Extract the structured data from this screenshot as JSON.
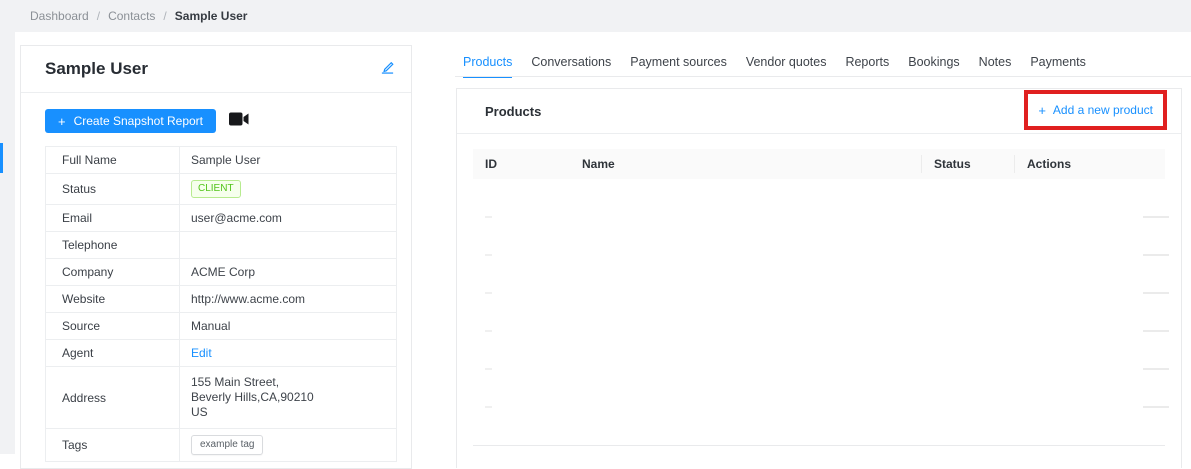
{
  "breadcrumb": {
    "separator": "/",
    "items": [
      {
        "label": "Dashboard",
        "current": false
      },
      {
        "label": "Contacts",
        "current": false
      },
      {
        "label": "Sample User",
        "current": true
      }
    ]
  },
  "contact_card": {
    "title": "Sample User",
    "edit_icon": "pencil-edit-icon",
    "snapshot_button": {
      "icon": "plus-icon",
      "label": "Create Snapshot Report"
    },
    "camera_icon": "video-camera-icon",
    "fields": [
      {
        "label": "Full Name",
        "type": "text",
        "value": "Sample User"
      },
      {
        "label": "Status",
        "type": "badge",
        "value": "CLIENT"
      },
      {
        "label": "Email",
        "type": "text",
        "value": "user@acme.com"
      },
      {
        "label": "Telephone",
        "type": "text",
        "value": ""
      },
      {
        "label": "Company",
        "type": "text",
        "value": "ACME Corp"
      },
      {
        "label": "Website",
        "type": "text",
        "value": "http://www.acme.com"
      },
      {
        "label": "Source",
        "type": "text",
        "value": "Manual"
      },
      {
        "label": "Agent",
        "type": "link",
        "value": "Edit"
      },
      {
        "label": "Address",
        "type": "multiline",
        "lines": [
          "155 Main Street,",
          "Beverly Hills,CA,90210",
          "US"
        ]
      },
      {
        "label": "Tags",
        "type": "tag",
        "value": "example tag"
      }
    ]
  },
  "tabs": [
    {
      "label": "Products",
      "active": true
    },
    {
      "label": "Conversations",
      "active": false
    },
    {
      "label": "Payment sources",
      "active": false
    },
    {
      "label": "Vendor quotes",
      "active": false
    },
    {
      "label": "Reports",
      "active": false
    },
    {
      "label": "Bookings",
      "active": false
    },
    {
      "label": "Notes",
      "active": false
    },
    {
      "label": "Payments",
      "active": false
    }
  ],
  "products_panel": {
    "title": "Products",
    "add_button": {
      "icon": "plus-icon",
      "label": "Add a new product",
      "highlighted": true
    },
    "table": {
      "columns": [
        "ID",
        "Name",
        "Status",
        "Actions"
      ],
      "rows": [],
      "empty_row_count": 7
    }
  },
  "icons": {
    "plus_glyph": "+"
  },
  "colors": {
    "accent_blue": "#1890ff",
    "highlight_red": "#e02020",
    "status_green": "#52c41a",
    "status_green_bg": "#f6ffed",
    "status_green_border": "#b7eb8f",
    "border_gray": "#e9eaec",
    "topbar_gray": "#f1f2f4"
  }
}
